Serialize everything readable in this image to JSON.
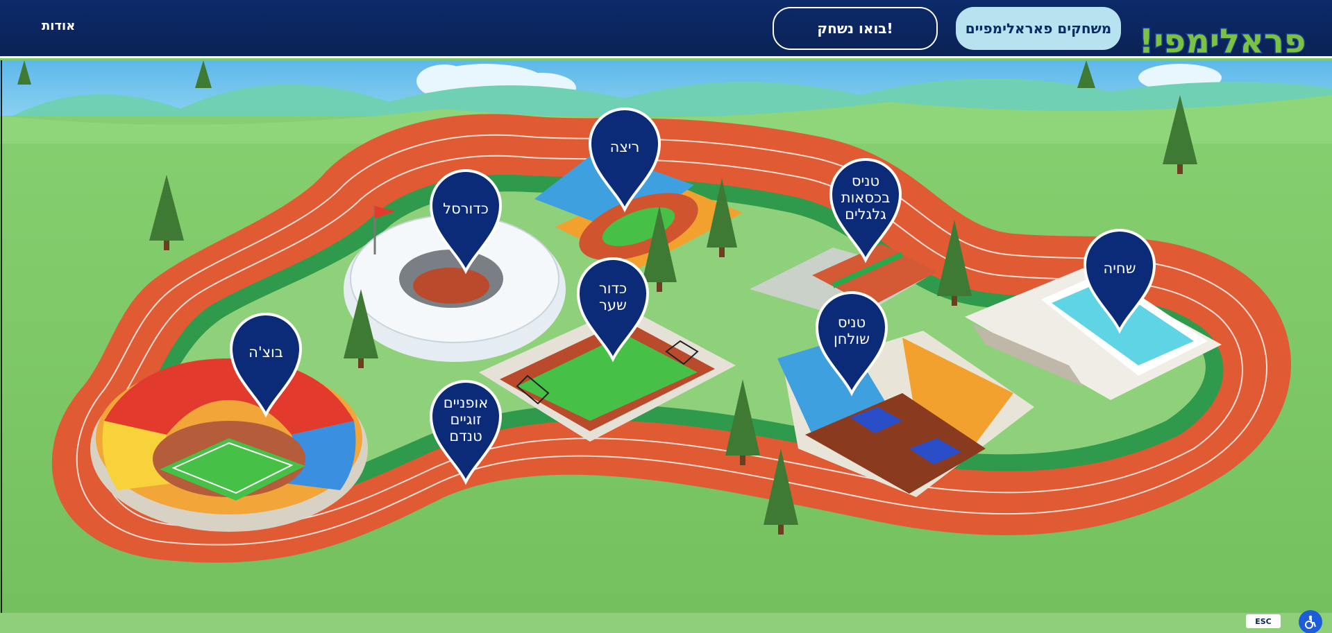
{
  "header": {
    "logo_text": "פראלימפי!",
    "nav": {
      "paralympic_games": "משחקים פאראלימפיים",
      "lets_play": "בואו נשחק!",
      "about": "אודות"
    }
  },
  "map": {
    "pins": [
      {
        "id": "running",
        "label": "ריצה"
      },
      {
        "id": "basketball",
        "label": "כדורסל"
      },
      {
        "id": "wheelchair-tennis",
        "label": "טניס\nבכסאות\nגלגלים"
      },
      {
        "id": "swimming",
        "label": "שחיה"
      },
      {
        "id": "goalball",
        "label": "כדור\nשער"
      },
      {
        "id": "table-tennis",
        "label": "טניס\nשולחן"
      },
      {
        "id": "boccia",
        "label": "בוצ'ה"
      },
      {
        "id": "tandem-cycling",
        "label": "אופניים\nזוגיים\nטנדם"
      }
    ]
  },
  "footer": {
    "esc_label": "ESC",
    "accessibility_icon": "accessibility-icon"
  },
  "colors": {
    "header_bg": "#0a2255",
    "active_button_bg": "#b7e3f0",
    "pin_bg": "#0b2a78",
    "track": "#e05a34",
    "grass": "#7ecb6a",
    "sky": "#6ec4ec"
  }
}
